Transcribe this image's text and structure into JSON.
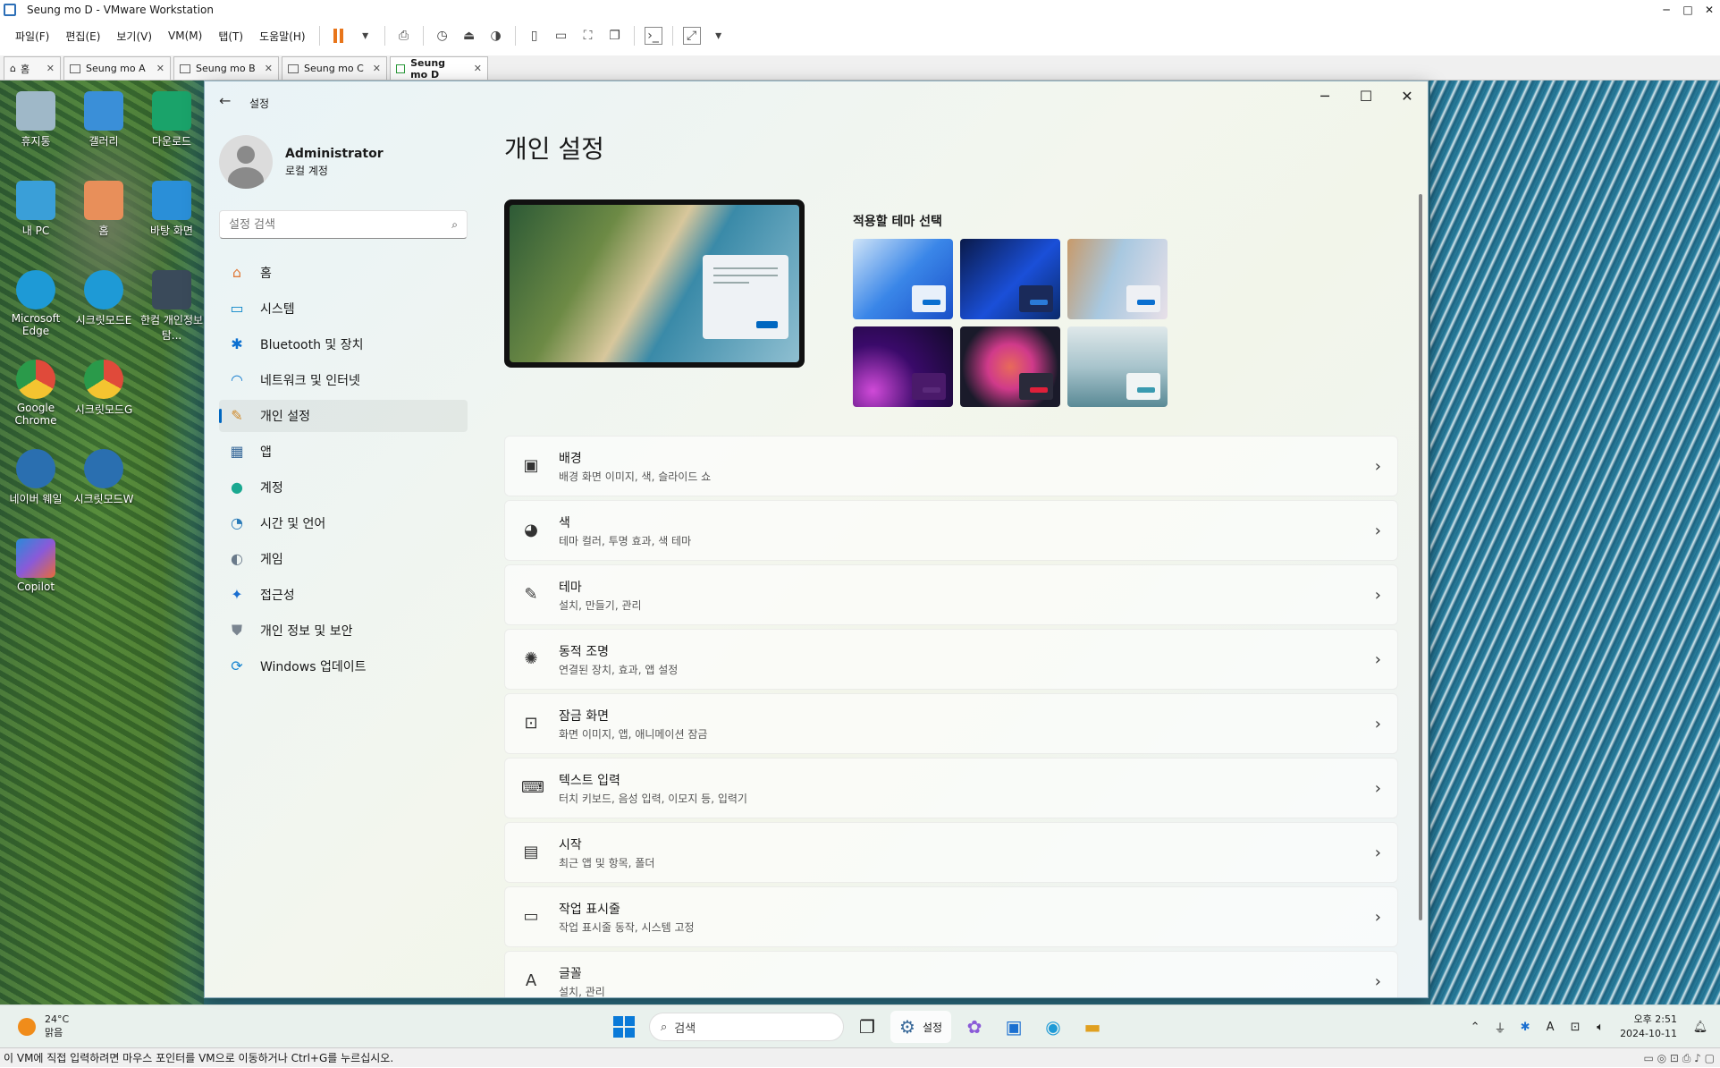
{
  "vmware": {
    "window_title": "Seung mo D - VMware Workstation",
    "menu": [
      "파일(F)",
      "편집(E)",
      "보기(V)",
      "VM(M)",
      "탭(T)",
      "도움말(H)"
    ],
    "tabs": [
      {
        "label": "홈",
        "active": false
      },
      {
        "label": "Seung mo A",
        "active": false
      },
      {
        "label": "Seung mo B",
        "active": false
      },
      {
        "label": "Seung mo C",
        "active": false
      },
      {
        "label": "Seung mo D",
        "active": true
      }
    ],
    "status_text": "이 VM에 직접 입력하려면 마우스 포인터를 VM으로 이동하거나 Ctrl+G를 누르십시오."
  },
  "desktop_icons": [
    {
      "label": "휴지통",
      "color": "#9fb8c8"
    },
    {
      "label": "갤러리",
      "color": "#3a8fd8"
    },
    {
      "label": "다운로드",
      "color": "#1aa36a"
    },
    {
      "label": "내 PC",
      "color": "#3a9fd8"
    },
    {
      "label": "홈",
      "color": "#e88f5a"
    },
    {
      "label": "바탕 화면",
      "color": "#2a8fd8"
    },
    {
      "label": "Microsoft Edge",
      "color": "#1e9ad6"
    },
    {
      "label": "시크릿모드E",
      "color": "#1e9ad6"
    },
    {
      "label": "한컴 개인정보탐...",
      "color": "#3a4a5a"
    },
    {
      "label": "Google Chrome",
      "color": "#e04a3a"
    },
    {
      "label": "시크릿모드G",
      "color": "#e04a3a"
    },
    {
      "label": "네이버 웨일",
      "color": "#2a6fb0"
    },
    {
      "label": "시크릿모드W",
      "color": "#2a6fb0"
    },
    {
      "label": "Copilot",
      "color": "#8a5ad8"
    }
  ],
  "settings": {
    "window_title": "설정",
    "user": {
      "name": "Administrator",
      "account": "로컬 계정"
    },
    "search_placeholder": "설정 검색",
    "nav": [
      {
        "label": "홈",
        "icon": "home-icon",
        "glyph": "⌂",
        "color": "#e07a3a",
        "selected": false
      },
      {
        "label": "시스템",
        "icon": "system-icon",
        "glyph": "▭",
        "color": "#0a85c8",
        "selected": false
      },
      {
        "label": "Bluetooth 및 장치",
        "icon": "bluetooth-icon",
        "glyph": "✱",
        "color": "#0a6fd0",
        "selected": false
      },
      {
        "label": "네트워크 및 인터넷",
        "icon": "wifi-icon",
        "glyph": "◠",
        "color": "#1a7fd0",
        "selected": false
      },
      {
        "label": "개인 설정",
        "icon": "brush-icon",
        "glyph": "✎",
        "color": "#d08a2a",
        "selected": true
      },
      {
        "label": "앱",
        "icon": "apps-icon",
        "glyph": "▦",
        "color": "#3a6a9a",
        "selected": false
      },
      {
        "label": "계정",
        "icon": "account-icon",
        "glyph": "●",
        "color": "#1aa890",
        "selected": false
      },
      {
        "label": "시간 및 언어",
        "icon": "clock-icon",
        "glyph": "◔",
        "color": "#2a7ab8",
        "selected": false
      },
      {
        "label": "게임",
        "icon": "gamepad-icon",
        "glyph": "◐",
        "color": "#6a7a8a",
        "selected": false
      },
      {
        "label": "접근성",
        "icon": "accessibility-icon",
        "glyph": "✦",
        "color": "#1a6fd0",
        "selected": false
      },
      {
        "label": "개인 정보 및 보안",
        "icon": "shield-icon",
        "glyph": "⛊",
        "color": "#7a8590",
        "selected": false
      },
      {
        "label": "Windows 업데이트",
        "icon": "update-icon",
        "glyph": "⟳",
        "color": "#1a85d0",
        "selected": false
      }
    ],
    "page_title": "개인 설정",
    "themes_label": "적용할 테마 선택",
    "themes": [
      {
        "name": "theme-windows-light",
        "bg": "linear-gradient(135deg,#cfe4f8 0%,#3a86e8 50%,#1a4fc8 100%)",
        "panel": "#e8f0fa",
        "accent": "#0a6fd0"
      },
      {
        "name": "theme-windows-dark",
        "bg": "linear-gradient(135deg,#0a1a4a 0%,#1a4fd8 55%,#0a2a6a 100%)",
        "panel": "#1a2a5a",
        "accent": "#2a7ad8"
      },
      {
        "name": "theme-flowers",
        "bg": "linear-gradient(110deg,#c89a6a 0%,#a8c8e0 45%,#e8e0e8 100%)",
        "panel": "#eef0f4",
        "accent": "#0a6fd0"
      },
      {
        "name": "theme-glow",
        "bg": "radial-gradient(circle at 20% 80%,#d04ad8 0%,#3a0a6a 45%,#120a2a 100%)",
        "panel": "#4a1a6a",
        "accent": "#5a2a7a"
      },
      {
        "name": "theme-captured-motion",
        "bg": "radial-gradient(circle at 50% 50%,#e86a5a 0%,#d03a8a 35%,#1a1a2a 75%)",
        "panel": "#2a2a3a",
        "accent": "#e0203a"
      },
      {
        "name": "theme-sunrise",
        "bg": "linear-gradient(180deg,#dfe8ea 0%,#a8c4cc 50%,#5a8a96 100%)",
        "panel": "#f0f4f4",
        "accent": "#3a9ab0"
      }
    ],
    "cards": [
      {
        "title": "배경",
        "subtitle": "배경 화면 이미지, 색, 슬라이드 쇼",
        "icon": "picture-icon",
        "glyph": "▣"
      },
      {
        "title": "색",
        "subtitle": "테마 컬러, 투명 효과, 색 테마",
        "icon": "palette-icon",
        "glyph": "◕"
      },
      {
        "title": "테마",
        "subtitle": "설치, 만들기, 관리",
        "icon": "brush-icon",
        "glyph": "✎"
      },
      {
        "title": "동적 조명",
        "subtitle": "연결된 장치, 효과, 앱 설정",
        "icon": "sun-icon",
        "glyph": "✺"
      },
      {
        "title": "잠금 화면",
        "subtitle": "화면 이미지, 앱, 애니메이션 잠금",
        "icon": "lock-screen-icon",
        "glyph": "⊡"
      },
      {
        "title": "텍스트 입력",
        "subtitle": "터치 키보드, 음성 입력, 이모지 등, 입력기",
        "icon": "keyboard-icon",
        "glyph": "⌨"
      },
      {
        "title": "시작",
        "subtitle": "최근 앱 및 항목, 폴더",
        "icon": "start-icon",
        "glyph": "▤"
      },
      {
        "title": "작업 표시줄",
        "subtitle": "작업 표시줄 동작, 시스템 고정",
        "icon": "taskbar-icon",
        "glyph": "▭"
      },
      {
        "title": "글꼴",
        "subtitle": "설치, 관리",
        "icon": "font-icon",
        "glyph": "A"
      }
    ]
  },
  "taskbar": {
    "weather_temp": "24°C",
    "weather_desc": "맑음",
    "search_placeholder": "검색",
    "active_app_label": "설정",
    "time": "오후 2:51",
    "date": "2024-10-11"
  }
}
